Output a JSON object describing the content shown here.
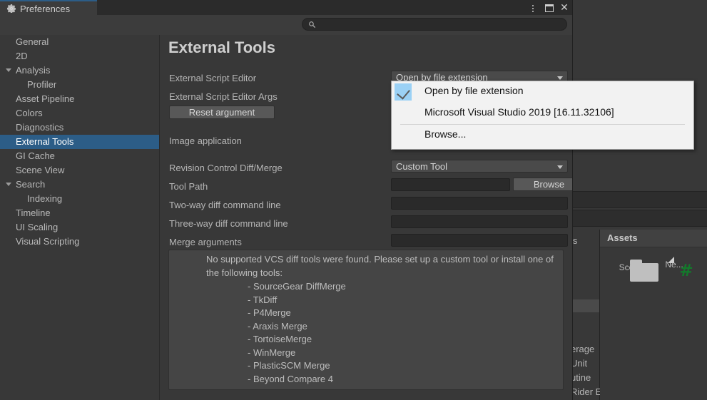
{
  "window": {
    "tab_label": "Preferences",
    "tab_icon": "gear-icon",
    "controls": {
      "menu": "kebab-menu-icon",
      "maximize": "maximize-icon",
      "close": "close-icon"
    }
  },
  "search": {
    "value": "",
    "placeholder": "",
    "icon": "search-icon"
  },
  "sidebar": {
    "items": [
      {
        "label": "General",
        "depth": 0,
        "arrow": false,
        "selected": false
      },
      {
        "label": "2D",
        "depth": 0,
        "arrow": false,
        "selected": false
      },
      {
        "label": "Analysis",
        "depth": 0,
        "arrow": true,
        "selected": false
      },
      {
        "label": "Profiler",
        "depth": 1,
        "arrow": false,
        "selected": false
      },
      {
        "label": "Asset Pipeline",
        "depth": 0,
        "arrow": false,
        "selected": false
      },
      {
        "label": "Colors",
        "depth": 0,
        "arrow": false,
        "selected": false
      },
      {
        "label": "Diagnostics",
        "depth": 0,
        "arrow": false,
        "selected": false
      },
      {
        "label": "External Tools",
        "depth": 0,
        "arrow": false,
        "selected": true
      },
      {
        "label": "GI Cache",
        "depth": 0,
        "arrow": false,
        "selected": false
      },
      {
        "label": "Scene View",
        "depth": 0,
        "arrow": false,
        "selected": false
      },
      {
        "label": "Search",
        "depth": 0,
        "arrow": true,
        "selected": false
      },
      {
        "label": "Indexing",
        "depth": 1,
        "arrow": false,
        "selected": false
      },
      {
        "label": "Timeline",
        "depth": 0,
        "arrow": false,
        "selected": false
      },
      {
        "label": "UI Scaling",
        "depth": 0,
        "arrow": false,
        "selected": false
      },
      {
        "label": "Visual Scripting",
        "depth": 0,
        "arrow": false,
        "selected": false
      }
    ]
  },
  "main": {
    "title": "External Tools",
    "labels": {
      "external_script_editor": "External Script Editor",
      "external_script_editor_args": "External Script Editor Args",
      "image_application": "Image application",
      "revision_control": "Revision Control Diff/Merge",
      "tool_path": "Tool Path",
      "two_way": "Two-way diff command line",
      "three_way": "Three-way diff command line",
      "merge_arguments": "Merge arguments"
    },
    "values": {
      "external_script_editor": "Open by file extension",
      "revision_control": "Custom Tool",
      "tool_path": "",
      "two_way": "",
      "three_way": "",
      "merge_arguments": ""
    },
    "buttons": {
      "reset_argument": "Reset argument",
      "browse_tool_path": "Browse"
    },
    "infobox": {
      "paragraph": "No supported VCS diff tools were found. Please set up a custom tool or install one of the following tools:",
      "tools": [
        "- SourceGear DiffMerge",
        "- TkDiff",
        "- P4Merge",
        "- Araxis Merge",
        "- TortoiseMerge",
        "- WinMerge",
        "- PlasticSCM Merge",
        "- Beyond Compare 4"
      ]
    }
  },
  "dropdown": {
    "options": [
      {
        "label": "Open by file extension",
        "checked": true
      },
      {
        "label": "Microsoft Visual Studio 2019 [16.11.32106]",
        "checked": false
      }
    ],
    "browse": "Browse..."
  },
  "background": {
    "assets_panel_title": "Assets",
    "assets": [
      {
        "label": "Sce...",
        "icon": "folder-icon"
      },
      {
        "label": "Ne...",
        "icon": "csharp-file-icon"
      }
    ],
    "clipped_text": [
      "ls",
      "erage",
      "Unit",
      "utine",
      "Rider E"
    ]
  },
  "colors": {
    "accent_blue": "#2c5d87",
    "panel_bg": "#383838",
    "field_bg": "#2a2a2a",
    "popup_bg": "#f2f2f2",
    "check_highlight": "#9bd1f5",
    "csharp_green": "#13792b"
  }
}
